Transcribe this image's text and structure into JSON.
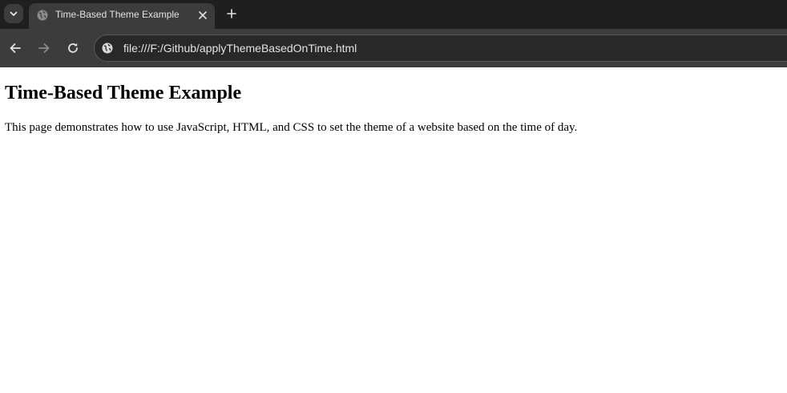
{
  "browser": {
    "tab": {
      "title": "Time-Based Theme Example"
    },
    "address_bar": {
      "url": "file:///F:/Github/applyThemeBasedOnTime.html"
    },
    "colors": {
      "tabstrip_bg": "#1f1f1f",
      "toolbar_bg": "#3c3c3c",
      "omnibox_bg": "#282828",
      "ui_text": "#e3e3e3"
    },
    "icons": {
      "tab_search": "chevron-down-icon",
      "favicon": "globe-icon",
      "tab_close": "close-icon",
      "new_tab": "plus-icon",
      "back": "arrow-left-icon",
      "forward": "arrow-right-icon",
      "reload": "reload-icon",
      "site_info": "globe-icon"
    }
  },
  "page": {
    "heading": "Time-Based Theme Example",
    "paragraph": "This page demonstrates how to use JavaScript, HTML, and CSS to set the theme of a website based on the time of day."
  }
}
